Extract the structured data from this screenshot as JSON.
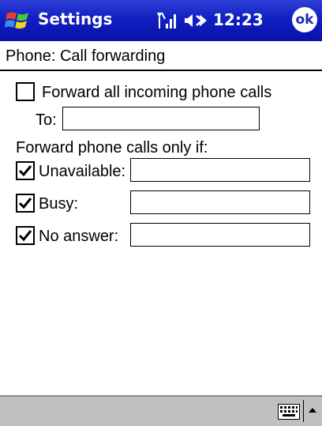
{
  "titlebar": {
    "title": "Settings",
    "time": "12:23",
    "ok_label": "ok",
    "icons": [
      "windows-start-icon",
      "signal-icon",
      "speaker-icon"
    ]
  },
  "page": {
    "heading": "Phone: Call forwarding"
  },
  "form": {
    "forward_all": {
      "label": "Forward all incoming phone calls",
      "checked": false
    },
    "to_label": "To:",
    "to_value": "",
    "conditional_heading": "Forward phone calls only if:",
    "conditions": [
      {
        "label": "Unavailable:",
        "checked": true,
        "value": ""
      },
      {
        "label": "Busy:",
        "checked": true,
        "value": ""
      },
      {
        "label": "No answer:",
        "checked": true,
        "value": ""
      }
    ]
  },
  "bottombar": {
    "icons": [
      "keyboard-icon",
      "sip-arrow-up-icon"
    ]
  },
  "colors": {
    "titlebar": "#1020c0",
    "bottombar": "#c0c0c0"
  }
}
